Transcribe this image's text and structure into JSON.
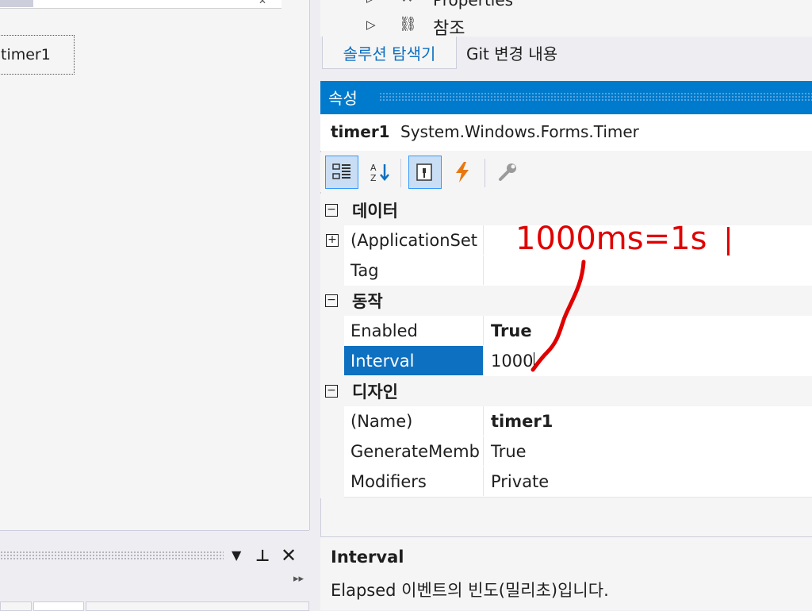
{
  "designer": {
    "component_label": "timer1"
  },
  "solution_explorer": {
    "tree_items": [
      "Properties",
      "참조"
    ],
    "tabs": [
      {
        "label": "솔루션 탐색기",
        "active": true
      },
      {
        "label": "Git 변경 내용",
        "active": false
      }
    ]
  },
  "properties": {
    "title": "속성",
    "object_name": "timer1",
    "object_type": "System.Windows.Forms.Timer",
    "categories": [
      {
        "label": "데이터",
        "rows": [
          {
            "name": "(ApplicationSet",
            "value": "",
            "expandable": true
          },
          {
            "name": "Tag",
            "value": ""
          }
        ]
      },
      {
        "label": "동작",
        "rows": [
          {
            "name": "Enabled",
            "value": "True",
            "bold": true
          },
          {
            "name": "Interval",
            "value": "1000",
            "selected": true
          }
        ]
      },
      {
        "label": "디자인",
        "rows": [
          {
            "name": "(Name)",
            "value": "timer1",
            "bold": true
          },
          {
            "name": "GenerateMemb",
            "value": "True"
          },
          {
            "name": "Modifiers",
            "value": "Private"
          }
        ]
      }
    ],
    "description": {
      "title": "Interval",
      "text": "Elapsed 이벤트의 빈도(밀리초)입니다."
    }
  },
  "annotation": {
    "text": "1000ms=1s",
    "color": "#e00000"
  },
  "icons": {
    "categorized": "categorized-icon",
    "alphabetical": "alphabetical-icon",
    "properties": "properties-icon",
    "events": "events-icon",
    "property_pages": "wrench-icon"
  }
}
